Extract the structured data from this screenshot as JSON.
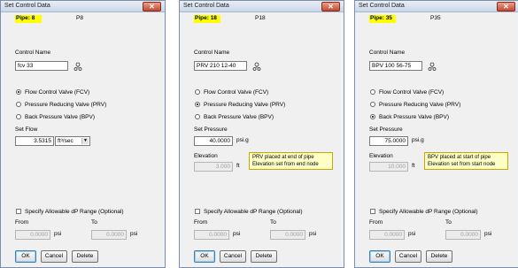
{
  "dialogs": [
    {
      "title": "Set Control Data",
      "pipe_label": "Pipe: 8",
      "pipe_name": "P8",
      "control_name_label": "Control Name",
      "control_name": "fcv 33",
      "radio_options": [
        "Flow Control Valve (FCV)",
        "Pressure Reducing Valve (PRV)",
        "Back Pressure Valve (BPV)"
      ],
      "selected_option": 0,
      "setpoint_label": "Set Flow",
      "setpoint_value": "3.5315",
      "setpoint_unit": "ft³/sec",
      "elevation_label": "",
      "elevation_value": "",
      "elevation_unit": "",
      "note": [],
      "dp_range_label": "Specify Allowable dP Range (Optional)",
      "from_label": "From",
      "to_label": "To",
      "from_value": "0.0000",
      "to_value": "0.0000",
      "dp_unit": "psi",
      "ok_label": "OK",
      "cancel_label": "Cancel",
      "delete_label": "Delete"
    },
    {
      "title": "Set Control Data",
      "pipe_label": "Pipe: 18",
      "pipe_name": "P18",
      "control_name_label": "Control Name",
      "control_name": "PRV 210 12-40",
      "radio_options": [
        "Flow Control Valve (FCV)",
        "Pressure Reducing Valve (PRV)",
        "Back Pressure Valve (BPV)"
      ],
      "selected_option": 1,
      "setpoint_label": "Set Pressure",
      "setpoint_value": "40.0000",
      "setpoint_unit": "psi.g",
      "elevation_label": "Elevation",
      "elevation_value": "3.000",
      "elevation_unit": "ft",
      "note": [
        "PRV placed at end of pipe",
        "Elevation set from end node"
      ],
      "dp_range_label": "Specify Allowable dP Range (Optional)",
      "from_label": "From",
      "to_label": "To",
      "from_value": "0.0000",
      "to_value": "0.0000",
      "dp_unit": "psi",
      "ok_label": "OK",
      "cancel_label": "Cancel",
      "delete_label": "Delete"
    },
    {
      "title": "Set Control Data",
      "pipe_label": "Pipe: 35",
      "pipe_name": "P35",
      "control_name_label": "Control Name",
      "control_name": "BPV 100 56-75",
      "radio_options": [
        "Flow Control Valve (FCV)",
        "Pressure Reducing Valve (PRV)",
        "Back Pressure Valve (BPV)"
      ],
      "selected_option": 2,
      "setpoint_label": "Set Pressure",
      "setpoint_value": "75.0000",
      "setpoint_unit": "psi.g",
      "elevation_label": "Elevation",
      "elevation_value": "10.000",
      "elevation_unit": "ft",
      "note": [
        "BPV placed at start of pipe",
        "Elevation set from start node"
      ],
      "dp_range_label": "Specify Allowable dP Range (Optional)",
      "from_label": "From",
      "to_label": "To",
      "from_value": "0.0000",
      "to_value": "0.0000",
      "dp_unit": "psi",
      "ok_label": "OK",
      "cancel_label": "Cancel",
      "delete_label": "Delete"
    }
  ],
  "colors": {
    "pipe_highlight": "#ffff00",
    "note_background": "#ffffc8",
    "close_button": "#c24a30"
  },
  "icons": {
    "close": "close-icon",
    "pick_control": "pick-control-icon"
  }
}
